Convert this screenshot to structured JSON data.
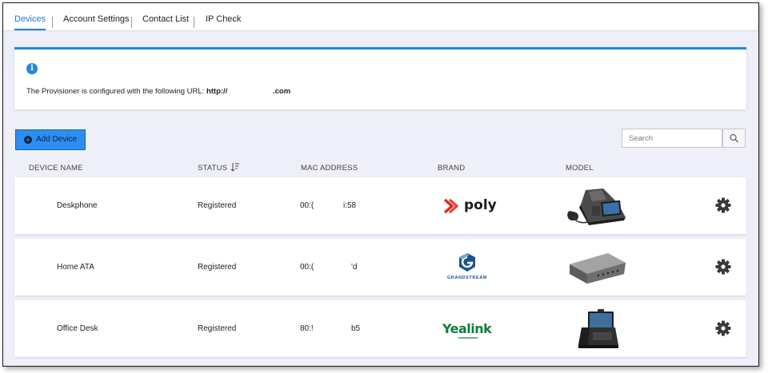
{
  "tabs": [
    {
      "label": "Devices",
      "active": true
    },
    {
      "label": "Account Settings",
      "active": false
    },
    {
      "label": "Contact List",
      "active": false
    },
    {
      "label": "IP Check",
      "active": false
    }
  ],
  "notice": {
    "text": "The Provisioner is configured with the following URL:",
    "url_prefix": "http://",
    "url_suffix": ".com"
  },
  "toolbar": {
    "add_label": "Add Device",
    "search_placeholder": "Search"
  },
  "table": {
    "headers": [
      "DEVICE NAME",
      "STATUS",
      "MAC ADDRESS",
      "BRAND",
      "MODEL"
    ],
    "rows": [
      {
        "name": "Deskphone",
        "status": "Registered",
        "mac_a": "00:(",
        "mac_b": "i:58",
        "brand": "poly"
      },
      {
        "name": "Home ATA",
        "status": "Registered",
        "mac_a": "00:(",
        "mac_b": "'d",
        "brand": "GRANDSTREAM"
      },
      {
        "name": "Office Desk",
        "status": "Registered",
        "mac_a": "80:!",
        "mac_b": "b5",
        "brand": "Yealink"
      }
    ]
  },
  "colors": {
    "accent": "#1e88e5",
    "button": "#2d8ef2",
    "poly_red": "#e2231a",
    "grandstream_blue": "#1d4f91",
    "yealink_green": "#0d7d3a"
  }
}
